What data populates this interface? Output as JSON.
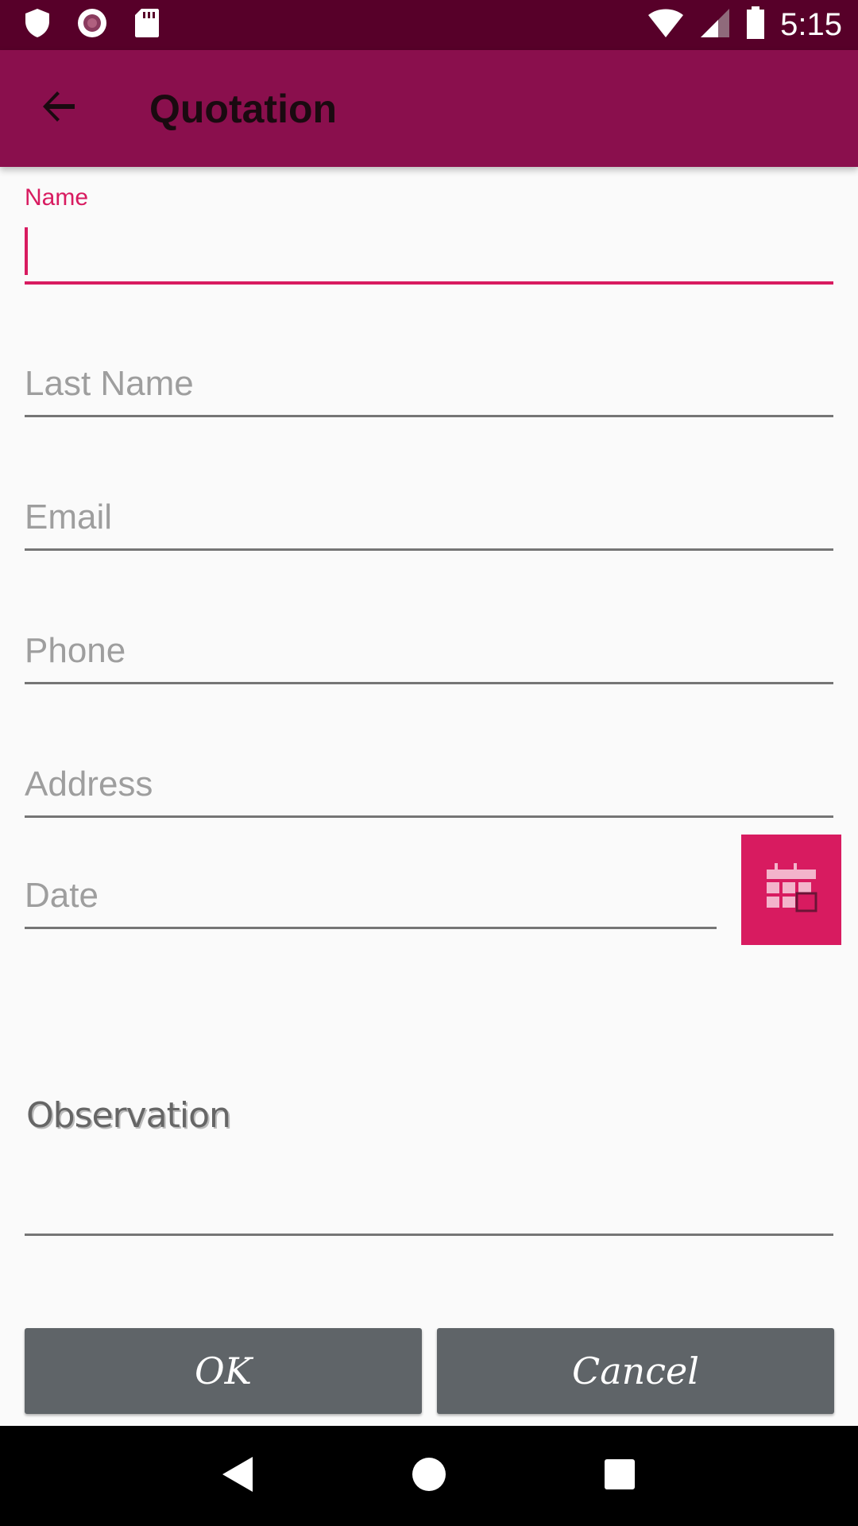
{
  "status_bar": {
    "time": "5:15",
    "icons": [
      "shield-icon",
      "record-icon",
      "sd-card-icon",
      "wifi-icon",
      "signal-icon",
      "battery-icon"
    ]
  },
  "app_bar": {
    "title": "Quotation",
    "back_icon": "arrow-back-icon"
  },
  "form": {
    "name": {
      "label": "Name",
      "value": ""
    },
    "last_name": {
      "placeholder": "Last Name"
    },
    "email": {
      "placeholder": "Email"
    },
    "phone": {
      "placeholder": "Phone"
    },
    "address": {
      "placeholder": "Address"
    },
    "date": {
      "placeholder": "Date",
      "button_icon": "calendar-icon"
    },
    "observation": {
      "label": "Observation"
    }
  },
  "actions": {
    "ok_label": "OK",
    "cancel_label": "Cancel"
  },
  "nav_bar": {
    "icons": [
      "nav-back-icon",
      "nav-home-icon",
      "nav-recents-icon"
    ]
  },
  "colors": {
    "status_bar": "#570029",
    "app_bar": "#8a0f4d",
    "accent": "#d81b60",
    "button": "#5f6468"
  }
}
